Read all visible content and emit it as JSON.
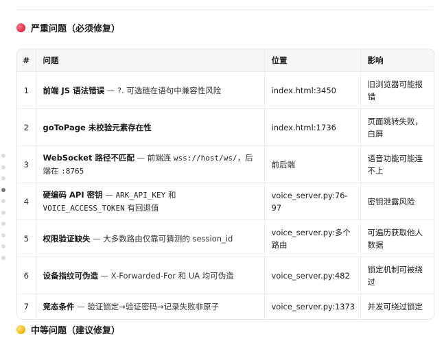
{
  "critical": {
    "title": "严重问题（必须修复）",
    "headers": [
      "#",
      "问题",
      "位置",
      "影响"
    ],
    "rows": [
      {
        "n": "1",
        "title": "前端 JS 语法错误",
        "desc_a": " — ?. 可选链在语句中兼容性风险",
        "location": "index.html:3450",
        "impact": "旧浏览器可能报错"
      },
      {
        "n": "2",
        "title": "goToPage 未校验元素存在性",
        "location": "index.html:1736",
        "impact": "页面跳转失败，白屏"
      },
      {
        "n": "3",
        "title": "WebSocket 路径不匹配",
        "desc_a": " — 前端连 ",
        "code1": "wss://host/ws/",
        "desc_b": "，后端在 ",
        "code2": ":8765",
        "location": "前后端",
        "impact": "语音功能可能连不上"
      },
      {
        "n": "4",
        "title": "硬编码 API 密钥",
        "desc_a": " — ",
        "code1": "ARK_API_KEY",
        "desc_b": " 和 ",
        "code2": "VOICE_ACCESS_TOKEN",
        "desc_c": " 有回退值",
        "location": "voice_server.py:76-97",
        "impact": "密钥泄露风险"
      },
      {
        "n": "5",
        "title": "权限验证缺失",
        "desc_a": " — 大多数路由仅靠可猜测的 session_id",
        "location": "voice_server.py:多个路由",
        "impact": "可遍历获取他人数据"
      },
      {
        "n": "6",
        "title": "设备指纹可伪造",
        "desc_a": " — X-Forwarded-For 和 UA 均可伪造",
        "location": "voice_server.py:482",
        "impact": "锁定机制可被绕过"
      },
      {
        "n": "7",
        "title": "竞态条件",
        "desc_a": " — 验证锁定→验证密码→记录失败非原子",
        "location": "voice_server.py:1373",
        "impact": "并发可绕过锁定"
      }
    ]
  },
  "medium": {
    "title": "中等问题（建议修复）"
  },
  "colors": {
    "critical_dot": "#e0243b",
    "medium_dot": "#f0b400"
  }
}
